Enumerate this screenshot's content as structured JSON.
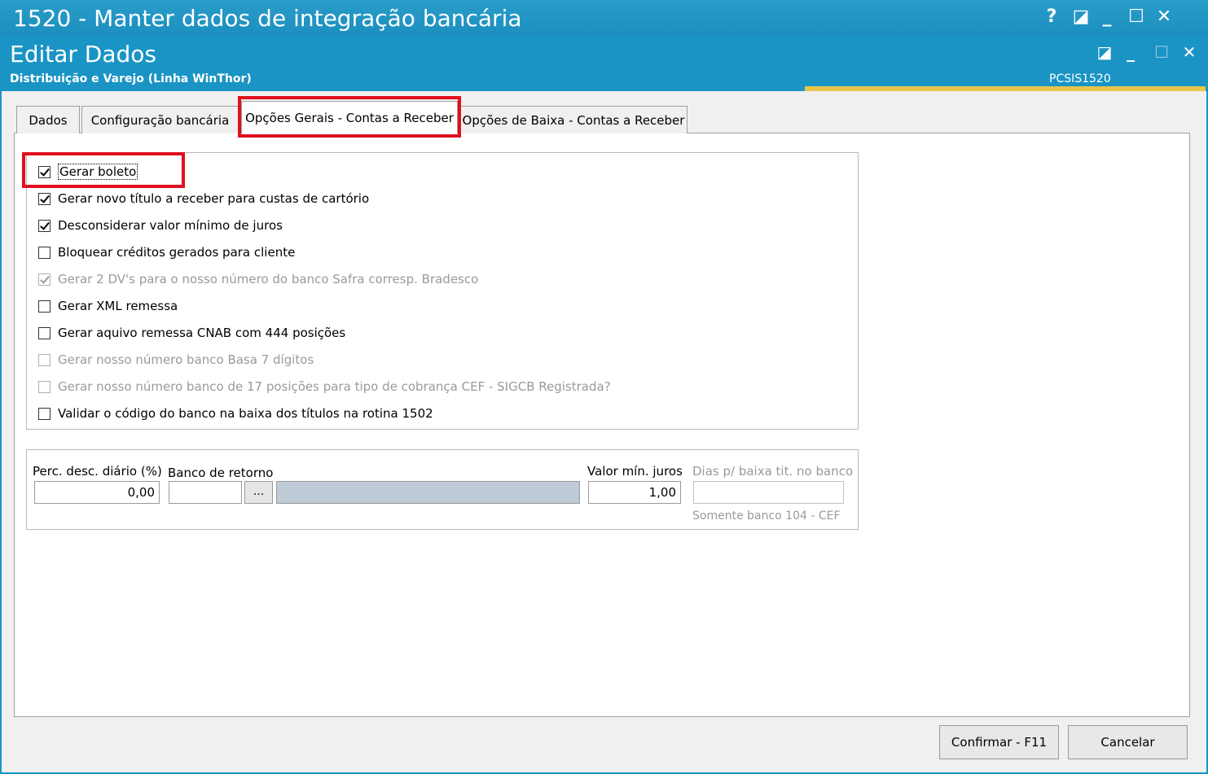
{
  "window": {
    "title": "1520 - Manter dados de integração bancária",
    "controls": {
      "help": "?",
      "edit": "◪",
      "minimize": "_",
      "maximize": "☐",
      "close": "✕"
    }
  },
  "header": {
    "title": "Editar Dados",
    "subtitle": "Distribuição e Varejo (Linha WinThor)",
    "code": "PCSIS1520"
  },
  "tabs": [
    {
      "label": "Dados"
    },
    {
      "label": "Configuração bancária"
    },
    {
      "label": "Opções Gerais - Contas a Receber"
    },
    {
      "label": "Opções de Baixa - Contas a Receber"
    }
  ],
  "options": [
    {
      "label": "Gerar boleto",
      "checked": true,
      "enabled": true
    },
    {
      "label": "Gerar novo título a receber para custas de cartório",
      "checked": true,
      "enabled": true
    },
    {
      "label": "Desconsiderar valor mínimo de juros",
      "checked": true,
      "enabled": true
    },
    {
      "label": "Bloquear créditos gerados para cliente",
      "checked": false,
      "enabled": true
    },
    {
      "label": "Gerar 2 DV's para o nosso número do banco Safra corresp. Bradesco",
      "checked": true,
      "enabled": false
    },
    {
      "label": "Gerar XML remessa",
      "checked": false,
      "enabled": true
    },
    {
      "label": "Gerar aquivo remessa CNAB com 444 posições",
      "checked": false,
      "enabled": true
    },
    {
      "label": "Gerar nosso número banco Basa 7 dígitos",
      "checked": false,
      "enabled": false
    },
    {
      "label": "Gerar nosso número banco de 17 posições para tipo de cobrança CEF - SIGCB Registrada?",
      "checked": false,
      "enabled": false
    },
    {
      "label": "Validar o código do banco na baixa dos títulos na rotina 1502",
      "checked": false,
      "enabled": true
    }
  ],
  "fields": {
    "perc_desc": {
      "label": "Perc. desc. diário (%)",
      "value": "0,00"
    },
    "banco_retorno": {
      "label": "Banco de retorno",
      "value": "",
      "lookup": "..."
    },
    "valor_min_juros": {
      "label": "Valor mín. juros",
      "value": "1,00"
    },
    "dias_baixa": {
      "label": "Dias p/ baixa tit. no banco",
      "value": "",
      "hint": "Somente banco 104 - CEF"
    }
  },
  "buttons": {
    "confirm": "Confirmar - F11",
    "cancel": "Cancelar"
  },
  "colors": {
    "titlebar": "#1b8fbf",
    "highlight": "#e0101e",
    "accent": "#e8c44a"
  }
}
